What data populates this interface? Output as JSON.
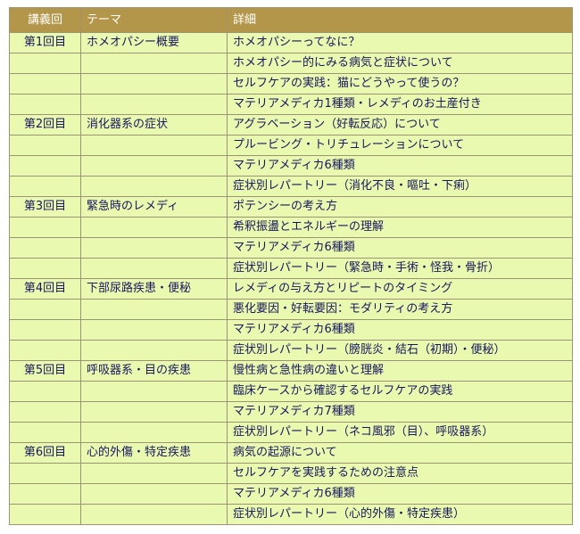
{
  "table": {
    "headers": [
      "講義回",
      "テーマ",
      "詳細"
    ],
    "rows": [
      [
        "第1回目",
        "ホメオパシー概要",
        "ホメオパシーってなに？"
      ],
      [
        "",
        "",
        "ホメオパシー的にみる病気と症状について"
      ],
      [
        "",
        "",
        "セルフケアの実践：猫にどうやって使うの？"
      ],
      [
        "",
        "",
        "マテリアメディカ1種類・レメディのお土産付き"
      ],
      [
        "第2回目",
        "消化器系の症状",
        "アグラベーション（好転反応）について"
      ],
      [
        "",
        "",
        "プルービング・トリチュレーションについて"
      ],
      [
        "",
        "",
        "マテリアメディカ6種類"
      ],
      [
        "",
        "",
        "症状別レパートリー（消化不良・嘔吐・下痢）"
      ],
      [
        "第3回目",
        "緊急時のレメディ",
        "ポテンシーの考え方"
      ],
      [
        "",
        "",
        "希釈振盪とエネルギーの理解"
      ],
      [
        "",
        "",
        "マテリアメディカ6種類"
      ],
      [
        "",
        "",
        "症状別レパートリー（緊急時・手術・怪我・骨折）"
      ],
      [
        "第4回目",
        "下部尿路疾患・便秘",
        "レメディの与え方とリピートのタイミング"
      ],
      [
        "",
        "",
        "悪化要因・好転要因：モダリティの考え方"
      ],
      [
        "",
        "",
        "マテリアメディカ6種類"
      ],
      [
        "",
        "",
        "症状別レパートリー（膀胱炎・結石（初期）・便秘）"
      ],
      [
        "第5回目",
        "呼吸器系・目の疾患",
        "慢性病と急性病の違いと理解"
      ],
      [
        "",
        "",
        "臨床ケースから確認するセルフケアの実践"
      ],
      [
        "",
        "",
        "マテリアメディカ7種類"
      ],
      [
        "",
        "",
        "症状別レパートリー（ネコ風邪（目）、呼吸器系）"
      ],
      [
        "第6回目",
        "心的外傷・特定疾患",
        "病気の起源について"
      ],
      [
        "",
        "",
        "セルフケアを実践するための注意点"
      ],
      [
        "",
        "",
        "マテリアメディカ6種類"
      ],
      [
        "",
        "",
        "症状別レパートリー（心的外傷・特定疾患）"
      ]
    ]
  }
}
